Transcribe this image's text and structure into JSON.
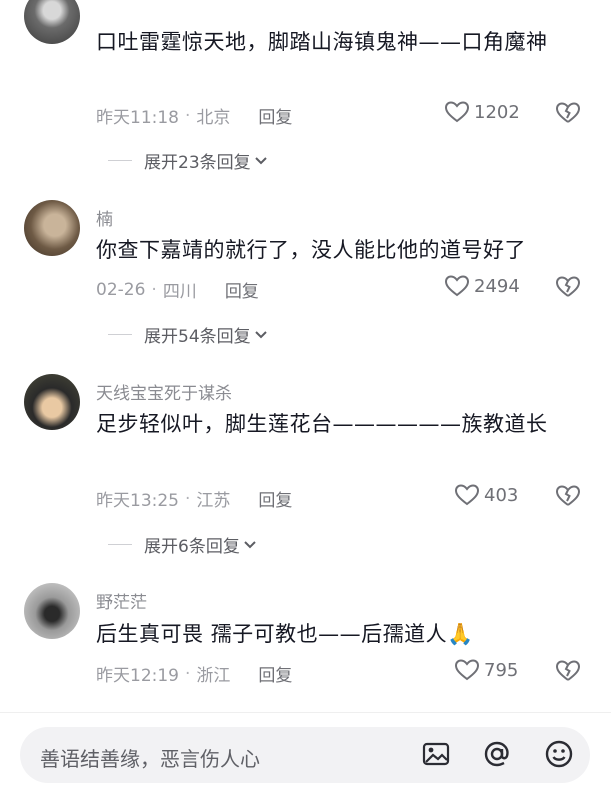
{
  "comments": [
    {
      "username": "",
      "text": "口吐雷霆惊天地，脚踏山海镇鬼神——口角魔神",
      "time": "昨天11:18",
      "location": "北京",
      "reply_label": "回复",
      "likes": "1202",
      "expand_label": "展开23条回复"
    },
    {
      "username": "楠",
      "text": "你查下嘉靖的就行了，没人能比他的道号好了",
      "time": "02-26",
      "location": "四川",
      "reply_label": "回复",
      "likes": "2494",
      "expand_label": "展开54条回复"
    },
    {
      "username": "天线宝宝死于谋杀",
      "text": "足步轻似叶，脚生莲花台——————族教道长",
      "time": "昨天13:25",
      "location": "江苏",
      "reply_label": "回复",
      "likes": "403",
      "expand_label": "展开6条回复"
    },
    {
      "username": "野茫茫",
      "text": "后生真可畏  孺子可教也——后孺道人🙏",
      "time": "昨天12:19",
      "location": "浙江",
      "reply_label": "回复",
      "likes": "795",
      "expand_label": ""
    }
  ],
  "bottom_bar": {
    "placeholder": "善语结善缘，恶言伤人心",
    "icons": [
      "image-icon",
      "at-icon",
      "emoji-icon"
    ]
  },
  "colors": {
    "text": "#161823",
    "meta": "#9a9ba1",
    "input_bg": "#f2f2f4"
  }
}
